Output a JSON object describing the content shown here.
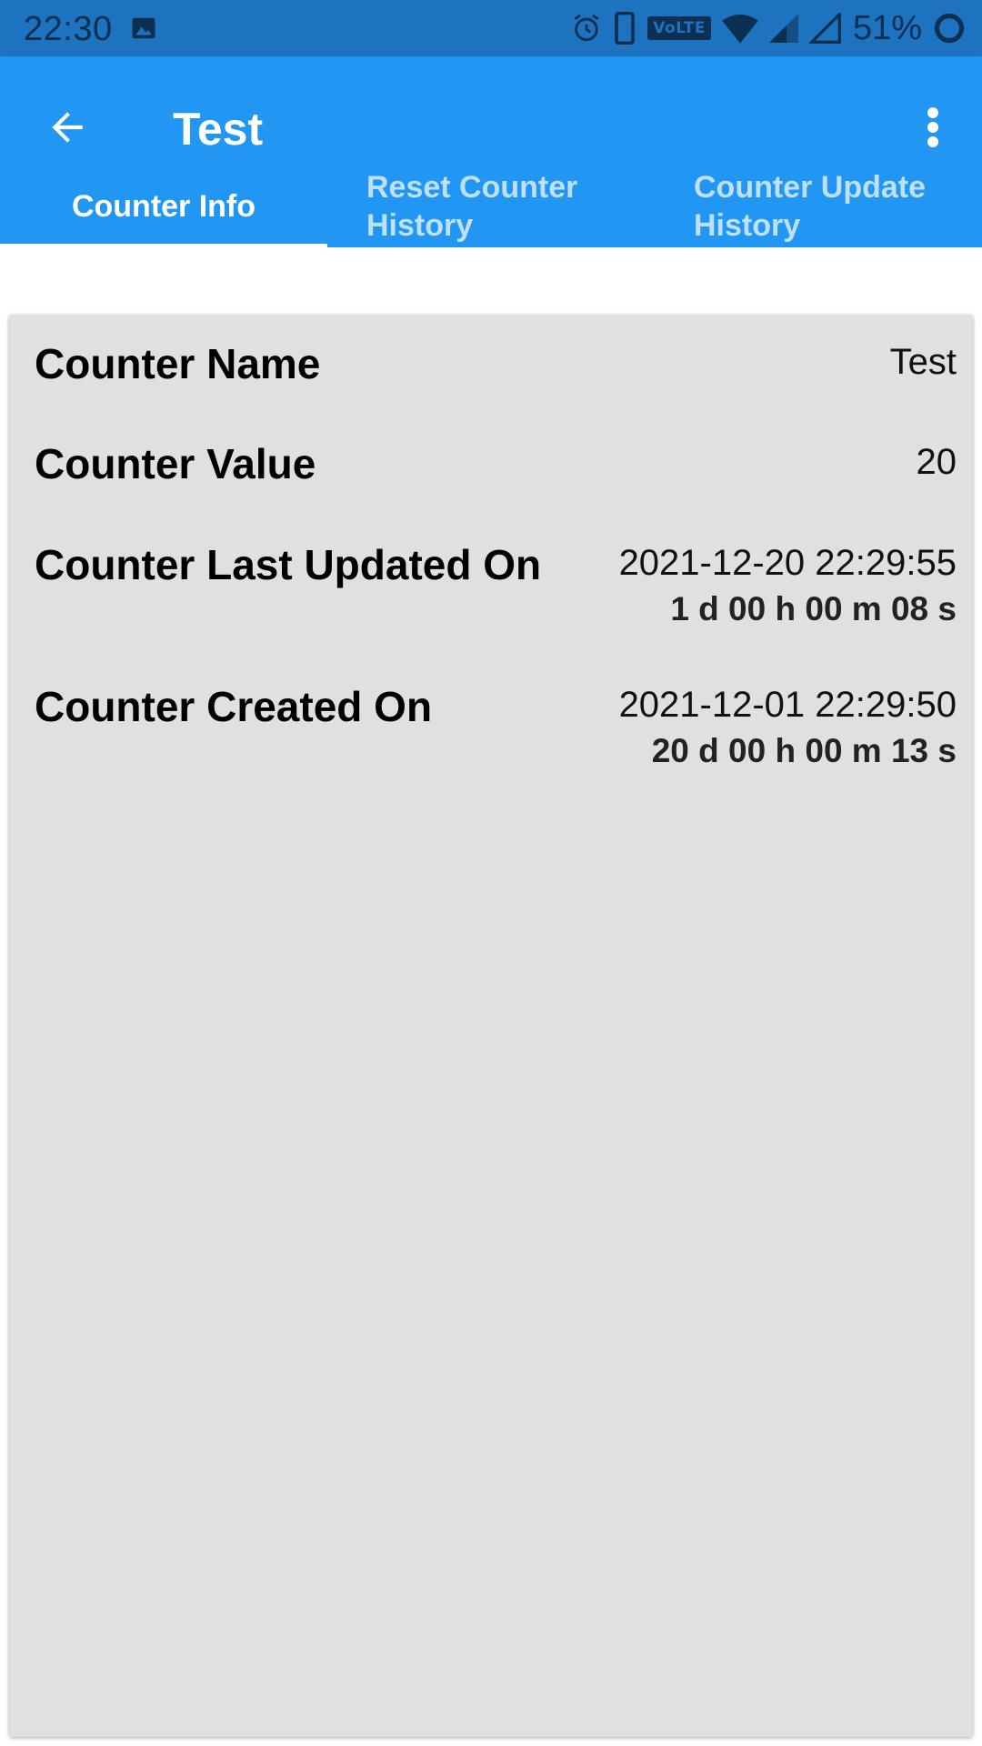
{
  "status_bar": {
    "time": "22:30",
    "network_badge": "VoLTE",
    "battery": "51%"
  },
  "app_bar": {
    "title": "Test",
    "back_icon": "arrow-back-icon",
    "menu_icon": "more-vertical-icon"
  },
  "tabs": [
    {
      "label": "Counter Info",
      "active": true
    },
    {
      "label": "Reset Counter History",
      "active": false
    },
    {
      "label": "Counter Update History",
      "active": false
    }
  ],
  "counter": {
    "name_label": "Counter Name",
    "name_value": "Test",
    "value_label": "Counter Value",
    "value_value": "20",
    "last_updated_label": "Counter Last Updated On",
    "last_updated_value": "2021-12-20 22:29:55",
    "last_updated_elapsed": "1 d 00 h 00 m 08 s",
    "created_label": "Counter Created On",
    "created_value": "2021-12-01 22:29:50",
    "created_elapsed": "20 d 00 h 00 m 13 s"
  },
  "colors": {
    "status_bar": "#1d73c0",
    "app_bar": "#2196f3",
    "card_background": "#e0e0e0",
    "tab_inactive": "#bfe0fb"
  }
}
